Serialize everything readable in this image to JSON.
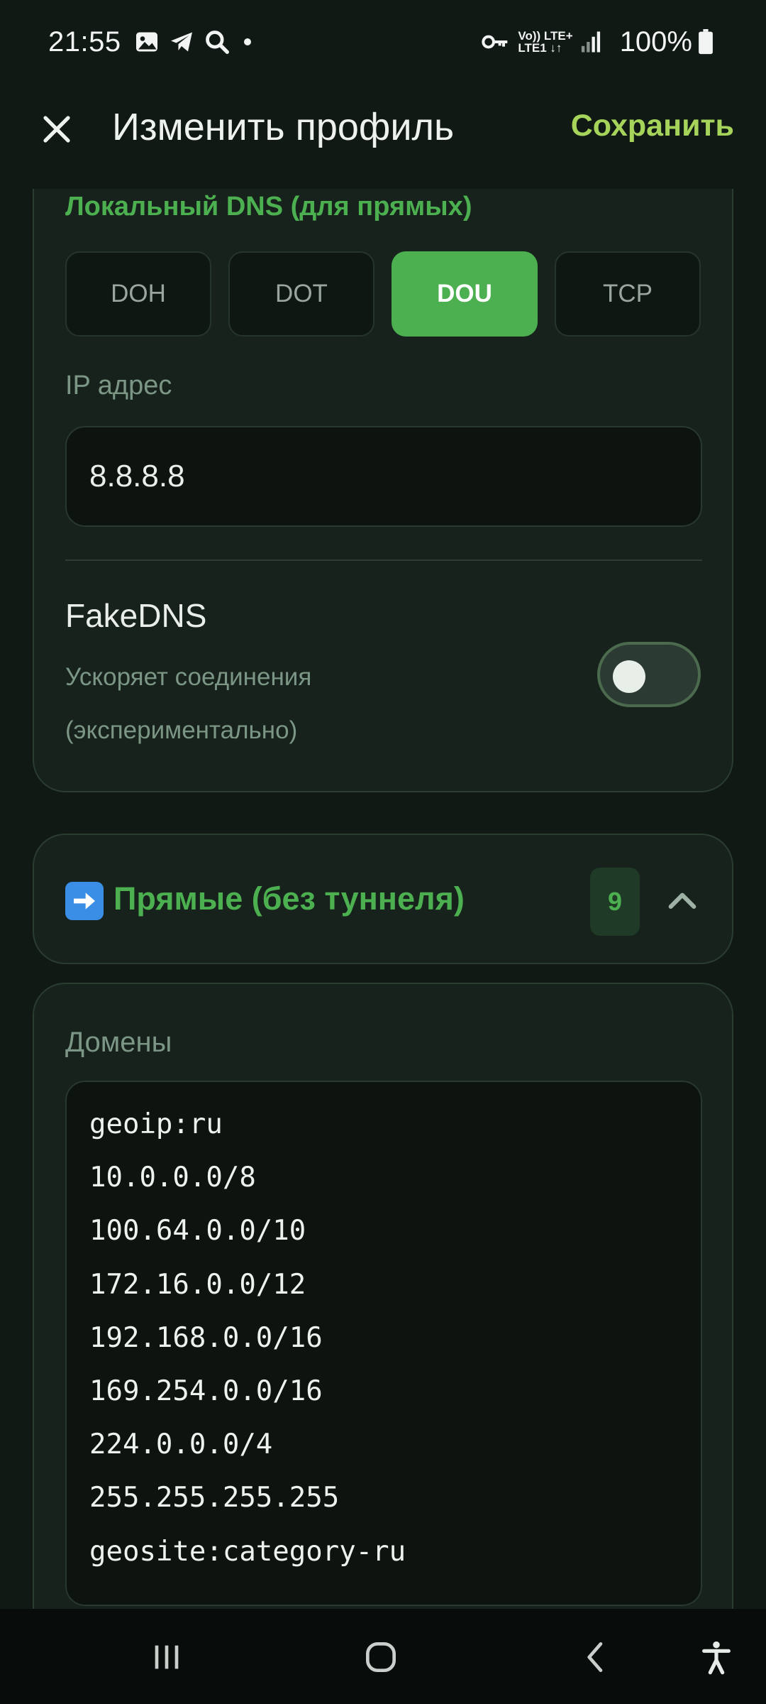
{
  "status_bar": {
    "time": "21:55",
    "network_line1": "Vo)) LTE+",
    "network_line2": "LTE1 ↓↑",
    "battery": "100%",
    "icons": [
      "gallery-icon",
      "telegram-icon",
      "search-icon",
      "dot-icon",
      "vpn-key-icon",
      "signal-icon",
      "battery-icon"
    ]
  },
  "app_bar": {
    "title": "Изменить профиль",
    "save_label": "Сохранить"
  },
  "local_dns": {
    "title": "Локальный DNS (для прямых)",
    "protocols": [
      "DOH",
      "DOT",
      "DOU",
      "TCP"
    ],
    "selected": "DOU",
    "ip_label": "IP адрес",
    "ip_value": "8.8.8.8",
    "fakedns_title": "FakeDNS",
    "fakedns_desc": "Ускоряет соединения (экспериментально)",
    "fakedns_enabled": false
  },
  "direct_section": {
    "title": "Прямые (без туннеля)",
    "count": "9",
    "expanded": true
  },
  "domains": {
    "label": "Домены",
    "lines": [
      "geoip:ru",
      "10.0.0.0/8",
      "100.64.0.0/10",
      "172.16.0.0/12",
      "192.168.0.0/16",
      "169.254.0.0/16",
      "224.0.0.0/4",
      "255.255.255.255",
      "geosite:category-ru"
    ]
  },
  "colors": {
    "accent": "#4caf50",
    "save": "#a6d35a",
    "background": "#111915",
    "card": "#16221b"
  }
}
